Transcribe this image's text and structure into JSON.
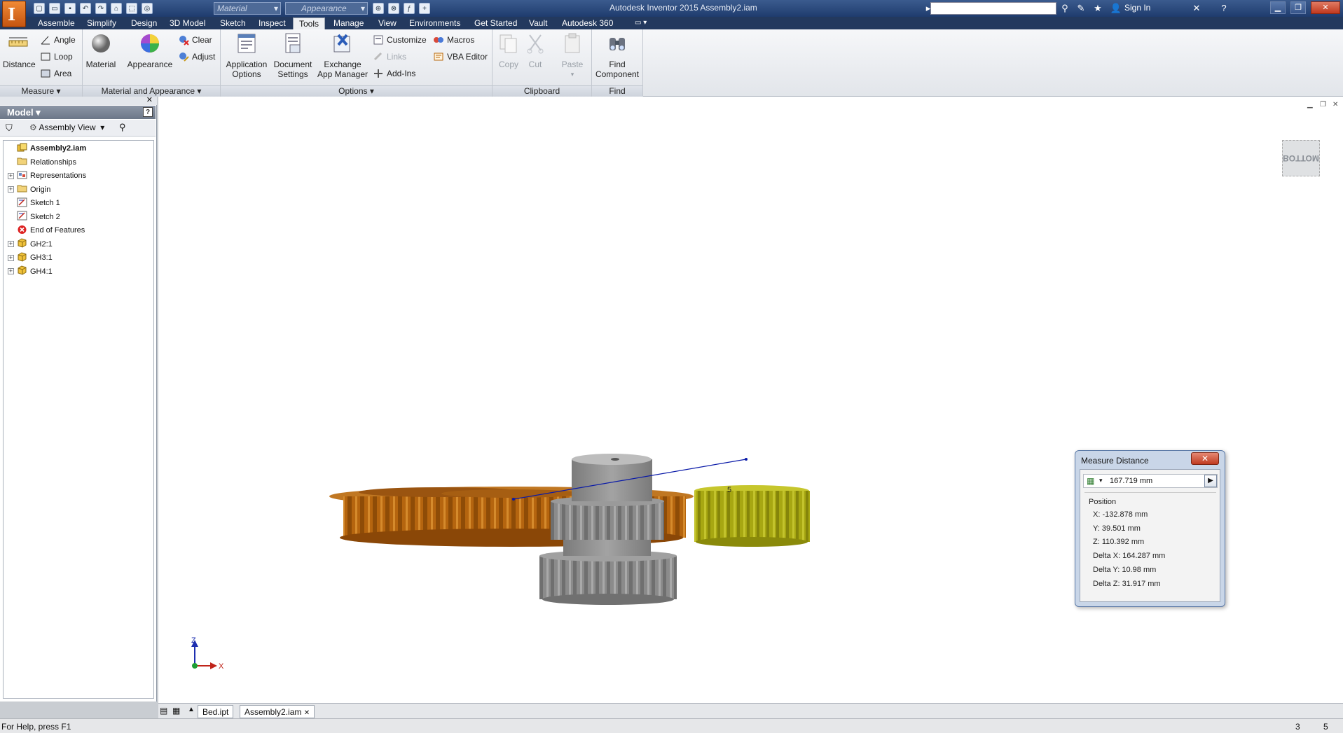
{
  "titlebar": {
    "title": "Autodesk Inventor 2015     Assembly2.iam",
    "material_placeholder": "Material",
    "appearance_placeholder": "Appearance",
    "sign_in": "Sign In"
  },
  "tabs": [
    "Assemble",
    "Simplify",
    "Design",
    "3D Model",
    "Sketch",
    "Inspect",
    "Tools",
    "Manage",
    "View",
    "Environments",
    "Get Started",
    "Vault",
    "Autodesk 360"
  ],
  "active_tab": "Tools",
  "ribbon": {
    "measure": {
      "distance": "Distance",
      "angle": "Angle",
      "loop": "Loop",
      "area": "Area",
      "title": "Measure"
    },
    "material_appearance": {
      "material": "Material",
      "appearance": "Appearance",
      "clear": "Clear",
      "adjust": "Adjust",
      "title": "Material and Appearance"
    },
    "options": {
      "application_options_1": "Application",
      "application_options_2": "Options",
      "document_settings_1": "Document",
      "document_settings_2": "Settings",
      "exchange_1": "Exchange",
      "exchange_2": "App Manager",
      "customize": "Customize",
      "links": "Links",
      "add_ins": "Add-Ins",
      "macros": "Macros",
      "vba_editor": "VBA Editor",
      "title": "Options"
    },
    "clipboard": {
      "copy": "Copy",
      "cut": "Cut",
      "paste": "Paste",
      "title": "Clipboard"
    },
    "find": {
      "find_1": "Find",
      "find_2": "Component",
      "title": "Find"
    }
  },
  "browser": {
    "header": "Model",
    "view": "Assembly View",
    "tree": [
      {
        "label": "Assembly2.iam",
        "bold": true,
        "expander": false,
        "icon": "assembly-icon"
      },
      {
        "label": "Relationships",
        "expander": false,
        "icon": "folder-icon"
      },
      {
        "label": "Representations",
        "expander": true,
        "icon": "representations-icon"
      },
      {
        "label": "Origin",
        "expander": true,
        "icon": "folder-icon"
      },
      {
        "label": "Sketch 1",
        "expander": false,
        "icon": "sketch-icon"
      },
      {
        "label": "Sketch 2",
        "expander": false,
        "icon": "sketch-icon"
      },
      {
        "label": "End of Features",
        "expander": false,
        "icon": "end-of-features-icon"
      },
      {
        "label": "GH2:1",
        "expander": true,
        "icon": "part-icon"
      },
      {
        "label": "GH3:1",
        "expander": true,
        "icon": "part-icon"
      },
      {
        "label": "GH4:1",
        "expander": true,
        "icon": "part-icon"
      }
    ]
  },
  "viewcube": {
    "face": "BOTTOM"
  },
  "triad": {
    "z": "Z",
    "x": "X"
  },
  "measure_dialog": {
    "title": "Measure Distance",
    "value": "167.719 mm",
    "position_label": "Position",
    "x": "X:  -132.878 mm",
    "y": "Y:  39.501 mm",
    "z": "Z:  110.392 mm",
    "dx": "Delta X:  164.287 mm",
    "dy": "Delta Y:  10.98 mm",
    "dz": "Delta Z:  31.917 mm"
  },
  "doc_tabs": [
    "Bed.ipt",
    "Assembly2.iam"
  ],
  "active_doc": "Assembly2.iam",
  "status": {
    "help": "For Help, press F1",
    "count_a": "3",
    "count_b": "5"
  },
  "colors": {
    "orange_gear": "#b86a10",
    "gray_gear": "#8c8c8c",
    "yellow_gear": "#a8a816",
    "measure_line": "#0a1aa8"
  }
}
